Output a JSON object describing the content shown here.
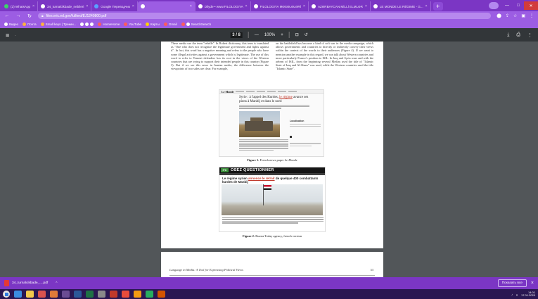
{
  "browser": {
    "tabs": [
      {
        "label": "(2) WhatsApp",
        "active": false
      },
      {
        "label": "34_turnalcikbade_nebileri",
        "active": false
      },
      {
        "label": "Google Переводчик",
        "active": false
      },
      {
        "label": "",
        "active": true
      },
      {
        "label": "Dilyde • www.FILOLOGIYA",
        "active": false
      },
      {
        "label": "FILOLOGIYA MƏSƏLƏLƏRİ",
        "active": false
      },
      {
        "label": "AZƏRBAYCAN MİLLİ ELMLƏR",
        "active": false
      },
      {
        "label": "LE MONDE LE RÉGIME - G...",
        "active": false
      }
    ],
    "url": "files.eric.ed.gov/fulltext/EJ1249800.pdf",
    "bookmarks": [
      "Видео",
      "Почта",
      "Small keys | Трекин...",
      "HomeHome",
      "YouTube",
      "Карты",
      "Gmail",
      "SearchSearch"
    ]
  },
  "pdf": {
    "page_indicator": "3 / 8",
    "zoom": "100%",
    "column_left": "These media use the term \"rebelle\". In Robert dictionary, this term is translated as \"One who does not recognize the legitimate government and fights against it\". In fact, this word has a negative meaning and refers to the people who have some illegal activities against a government which is legitimate. The use of this word to refer to Yemeni defenders has its root in the views of the Western countries that are trying to support their intended people in this country (Figure 3). But if we see this news in Iranian media, the difference between the viewpoints of two sides are clear. For example,",
    "column_right": "on the battlefield has become a kind of soft war in the media campaign, which allows governments and countries to directly or indirectly convey their views within the context of the words to their audiences (Figure 4). If we want to mention another example in this regard, we can talk about Western countries and more particularly France's position to ISIL. In Iraq and Syria wars and with the advent of ISIL, from the beginning several Medias used the title of \"Islamic State of Iraq and Al-Sham\" was used, while the Western countries used the title \"Islamic State\".",
    "figure1": {
      "site_logo": "Le Monde",
      "headline_before": "Syrie : à l'appel des Kurdes,",
      "headline_highlight": "le régime",
      "headline_after": "avance ses pions à Manbij et dans le nord",
      "sidebar_title": "Localisation",
      "caption_label": "Figure 1.",
      "caption_text": "French news paper",
      "caption_source": "Le Monde"
    },
    "figure2": {
      "banner_logo": "ITC",
      "banner_title": "OSEZ QUESTIONNER",
      "headline_before": "Le régime syrien",
      "headline_highlight": "annonce le retrait",
      "headline_after": "de quelque 400 combattants kurdes de Manbij",
      "caption_label": "Figure 2.",
      "caption_text": "Russia Today agency, french version"
    },
    "page2_running_head": "Language in Media: A Tool for Expressing Political Views",
    "page2_number": "33"
  },
  "downloads": {
    "file": "34_turnalcikbade_....pdf",
    "show_all": "Показать все"
  },
  "taskbar": {
    "time": "14:01",
    "date": "17.01.2020"
  }
}
